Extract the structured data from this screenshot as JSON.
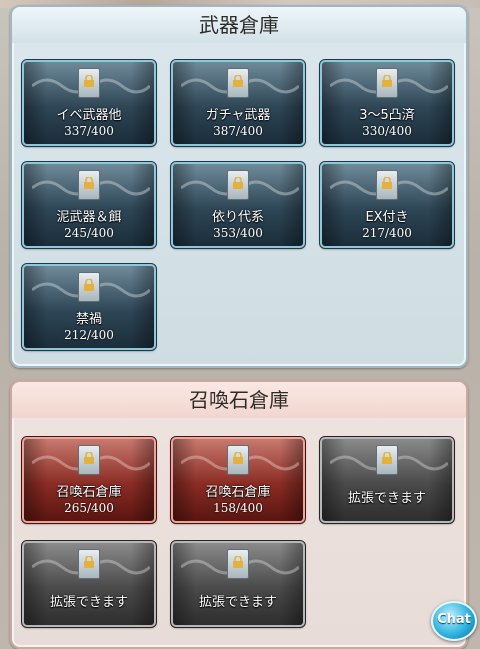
{
  "weapon_storage": {
    "title": "武器倉庫",
    "slots": [
      {
        "name": "イベ武器他",
        "count": "337/400"
      },
      {
        "name": "ガチャ武器",
        "count": "387/400"
      },
      {
        "name": "3～5凸済",
        "count": "330/400"
      },
      {
        "name": "泥武器＆餌",
        "count": "245/400"
      },
      {
        "name": "依り代系",
        "count": "353/400"
      },
      {
        "name": "EX付き",
        "count": "217/400"
      },
      {
        "name": "禁禍",
        "count": "212/400"
      }
    ]
  },
  "summon_storage": {
    "title": "召喚石倉庫",
    "slots": [
      {
        "name": "召喚石倉庫",
        "count": "265/400"
      },
      {
        "name": "召喚石倉庫",
        "count": "158/400"
      },
      {
        "name": "拡張できます",
        "count": ""
      },
      {
        "name": "拡張できます",
        "count": ""
      },
      {
        "name": "拡張できます",
        "count": ""
      }
    ]
  },
  "chat_button": {
    "label": "Chat"
  },
  "icons": {
    "lock": "lock-icon",
    "chain": "chain-icon"
  },
  "colors": {
    "weapon_slot_border": "#8fc7da",
    "summon_slot_border": "#e9a79c",
    "empty_slot_border": "#b7b7b7"
  }
}
